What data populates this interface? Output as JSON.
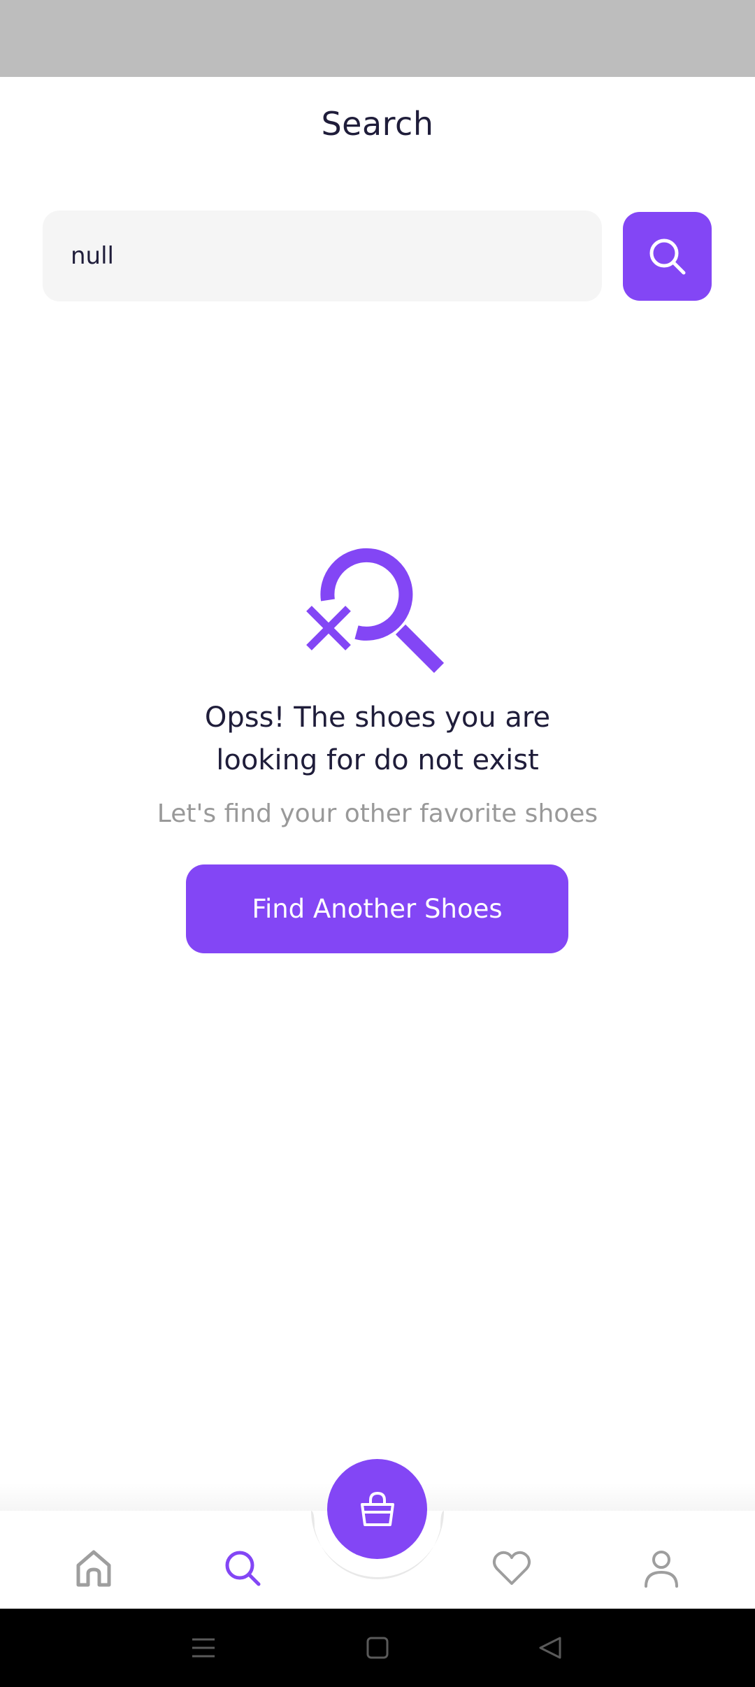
{
  "header": {
    "title": "Search"
  },
  "search": {
    "value": "null",
    "placeholder": ""
  },
  "empty_state": {
    "title_line1": "Opss! The shoes you are",
    "title_line2": "looking for do not exist",
    "subtitle": "Let's find your other favorite shoes",
    "button_label": "Find Another Shoes"
  },
  "bottom_nav": {
    "items": [
      {
        "icon": "home-icon",
        "active": false
      },
      {
        "icon": "search-icon",
        "active": true
      },
      {
        "icon": "heart-icon",
        "active": false
      },
      {
        "icon": "user-icon",
        "active": false
      }
    ],
    "center_button_icon": "shopping-bag-icon"
  },
  "system_nav": {
    "icons": [
      "menu-icon",
      "square-home-icon",
      "back-triangle-icon"
    ]
  },
  "colors": {
    "accent": "#8346f5",
    "text_primary": "#1f1d3a",
    "text_secondary": "#999999",
    "input_bg": "#f5f5f5",
    "icon_inactive": "#9e9e9e",
    "status_bar": "#bdbdbd"
  }
}
